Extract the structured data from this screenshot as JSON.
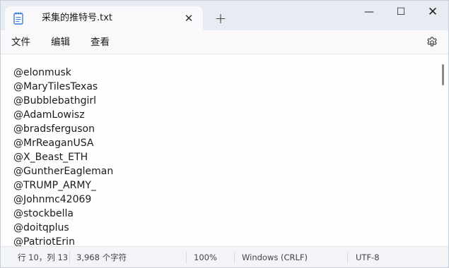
{
  "tab": {
    "title": "采集的推特号.txt",
    "close": "✕",
    "new_tab": "+"
  },
  "window_controls": {
    "minimize": "—",
    "maximize": "☐",
    "close": "✕"
  },
  "menu": {
    "file": "文件",
    "edit": "编辑",
    "view": "查看"
  },
  "editor": {
    "lines": [
      "@elonmusk",
      "@MaryTilesTexas",
      "@Bubblebathgirl",
      "@AdamLowisz",
      "@bradsferguson",
      "@MrReaganUSA",
      "@X_Beast_ETH",
      "@GuntherEagleman",
      "@TRUMP_ARMY_",
      "@Johnmc42069",
      "@stockbella",
      "@doitqplus",
      "@PatriotErin"
    ]
  },
  "status": {
    "position": "行 10，列 13",
    "chars": "3,968 个字符",
    "zoom": "100%",
    "line_endings": "Windows (CRLF)",
    "encoding": "UTF-8"
  },
  "icons": {
    "tab_icon": "notepad-icon",
    "settings": "gear-icon"
  },
  "colors": {
    "accent": "#3a7bd5"
  }
}
